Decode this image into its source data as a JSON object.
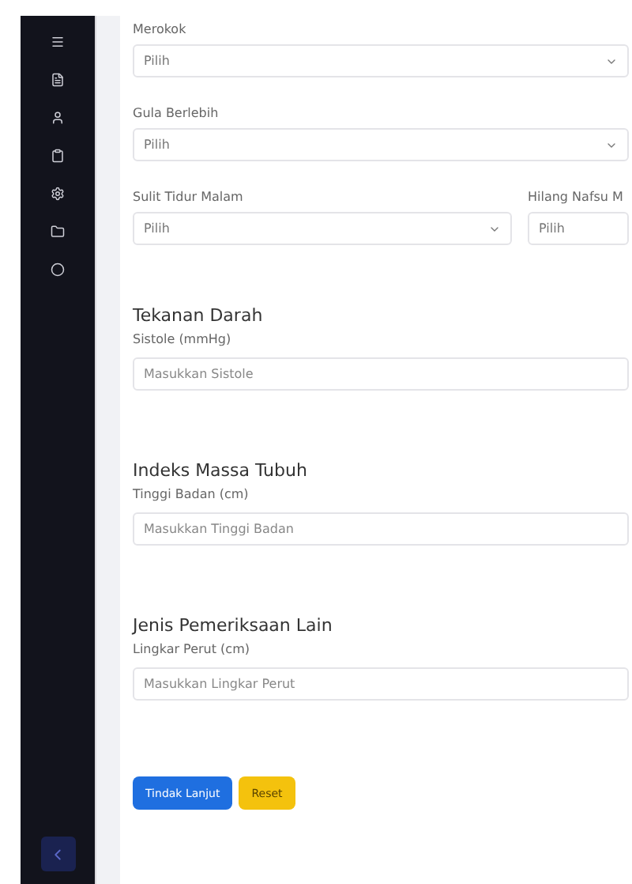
{
  "selects": [
    {
      "label": "Merokok",
      "value": "Pilih"
    },
    {
      "label": "Gula Berlebih",
      "value": "Pilih"
    }
  ],
  "select_pair": [
    {
      "label": "Sulit Tidur Malam",
      "value": "Pilih"
    },
    {
      "label": "Hilang Nafsu M",
      "value": "Pilih"
    }
  ],
  "sections": [
    {
      "title": "Tekanan Darah",
      "label": "Sistole (mmHg)",
      "placeholder": "Masukkan Sistole"
    },
    {
      "title": "Indeks Massa Tubuh",
      "label": "Tinggi Badan (cm)",
      "placeholder": "Masukkan Tinggi Badan"
    },
    {
      "title": "Jenis Pemeriksaan Lain",
      "label": "Lingkar Perut (cm)",
      "placeholder": "Masukkan Lingkar Perut"
    }
  ],
  "buttons": [
    {
      "kind": "primary",
      "label": "Tindak Lanjut"
    },
    {
      "kind": "warning",
      "label": "Reset"
    }
  ]
}
